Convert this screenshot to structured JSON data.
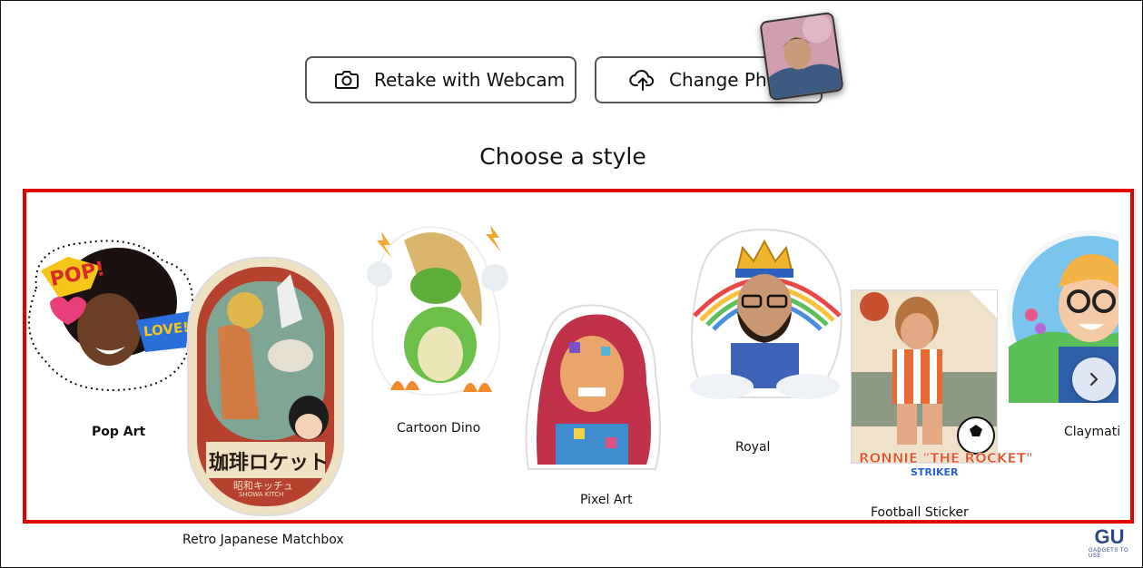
{
  "header": {
    "retake_label": "Retake with Webcam",
    "change_label": "Change Photo",
    "title": "Choose a style"
  },
  "styles": [
    {
      "label": "Pop Art",
      "badge_pop": "POP!",
      "badge_love": "LOVE!"
    },
    {
      "label": "Retro Japanese Matchbox",
      "sign": "珈琲ロケット",
      "sub": "昭和キッチュ",
      "sub2": "SHOWA KITCH"
    },
    {
      "label": "Cartoon Dino"
    },
    {
      "label": "Pixel Art"
    },
    {
      "label": "Royal"
    },
    {
      "label": "Football Sticker",
      "banner": "RONNIE \"THE ROCKET\"",
      "role": "STRIKER"
    },
    {
      "label": "Claymati"
    }
  ],
  "watermark": {
    "logo": "GU",
    "text": "GADGETS TO USE"
  },
  "colors": {
    "highlight": "#e00000",
    "border": "#555555"
  }
}
